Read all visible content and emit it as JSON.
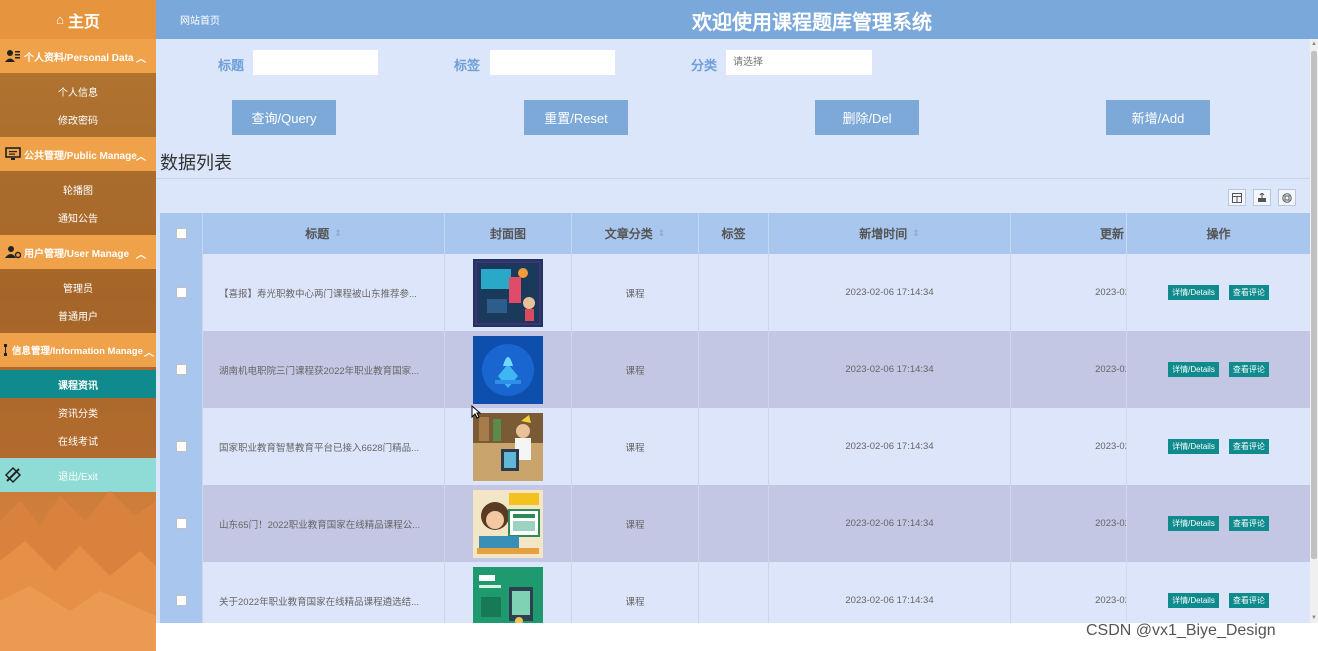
{
  "sidebar": {
    "home": "主页",
    "groups": [
      {
        "title": "个人资料/Personal Data",
        "items": [
          "个人信息",
          "修改密码"
        ]
      },
      {
        "title": "公共管理/Public Manage",
        "items": [
          "轮播图",
          "通知公告"
        ]
      },
      {
        "title": "用户管理/User Manage",
        "items": [
          "管理员",
          "普通用户"
        ]
      },
      {
        "title": "信息管理/Information Manage",
        "items": [
          "课程资讯",
          "资讯分类",
          "在线考试"
        ]
      }
    ],
    "exit": "退出/Exit"
  },
  "header": {
    "home_link": "网站首页",
    "title": "欢迎使用课程题库管理系统"
  },
  "filters": {
    "title_label": "标题",
    "tag_label": "标签",
    "category_label": "分类",
    "category_placeholder": "请选择"
  },
  "buttons": {
    "query": "查询/Query",
    "reset": "重置/Reset",
    "delete": "删除/Del",
    "add": "新增/Add"
  },
  "list_title": "数据列表",
  "table": {
    "columns": {
      "title": "标题",
      "cover": "封面图",
      "category": "文章分类",
      "tag": "标签",
      "created": "新增时间",
      "updated": "更新",
      "ops": "操作"
    },
    "details_label": "详情/Details",
    "comments_label": "查看评论",
    "rows": [
      {
        "title": "【喜报】寿光职教中心两门课程被山东推荐参...",
        "category": "课程",
        "tag": "",
        "created": "2023-02-06 17:14:34",
        "updated": "2023-02"
      },
      {
        "title": "湖南机电职院三门课程获2022年职业教育国家...",
        "category": "课程",
        "tag": "",
        "created": "2023-02-06 17:14:34",
        "updated": "2023-02"
      },
      {
        "title": "国家职业教育智慧教育平台已接入6628门精品...",
        "category": "课程",
        "tag": "",
        "created": "2023-02-06 17:14:34",
        "updated": "2023-02"
      },
      {
        "title": "山东65门！2022职业教育国家在线精品课程公...",
        "category": "课程",
        "tag": "",
        "created": "2023-02-06 17:14:34",
        "updated": "2023-02"
      },
      {
        "title": "关于2022年职业教育国家在线精品课程遴选结...",
        "category": "课程",
        "tag": "",
        "created": "2023-02-06 17:14:34",
        "updated": "2023-02"
      }
    ]
  },
  "watermark": "CSDN @vx1_Biye_Design"
}
